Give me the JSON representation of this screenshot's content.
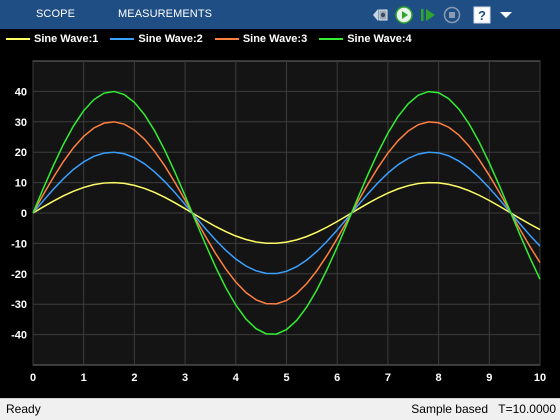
{
  "toolstrip": {
    "tabs": [
      {
        "label": "SCOPE"
      },
      {
        "label": "MEASUREMENTS"
      }
    ],
    "buttons": [
      {
        "icon": "snapshot-back-icon"
      },
      {
        "icon": "run-icon"
      },
      {
        "icon": "step-forward-icon"
      },
      {
        "icon": "stop-icon"
      },
      {
        "icon": "help-icon"
      },
      {
        "icon": "expand-icon"
      }
    ]
  },
  "legend": {
    "items": [
      {
        "label": "Sine Wave:1",
        "color": "#ffff66"
      },
      {
        "label": "Sine Wave:2",
        "color": "#3aa0ff"
      },
      {
        "label": "Sine Wave:3",
        "color": "#ff8040"
      },
      {
        "label": "Sine Wave:4",
        "color": "#33ee33"
      }
    ]
  },
  "chart_data": {
    "type": "line",
    "xlim": [
      0,
      10
    ],
    "ylim": [
      -50,
      50
    ],
    "xticks": [
      0,
      1,
      2,
      3,
      4,
      5,
      6,
      7,
      8,
      9,
      10
    ],
    "yticks": [
      -40,
      -30,
      -20,
      -10,
      0,
      10,
      20,
      30,
      40
    ],
    "grid": true,
    "x": [
      0,
      0.2,
      0.4,
      0.6,
      0.8,
      1.0,
      1.2,
      1.4,
      1.6,
      1.8,
      2.0,
      2.2,
      2.4,
      2.6,
      2.8,
      3.0,
      3.2,
      3.4,
      3.6,
      3.8,
      4.0,
      4.2,
      4.4,
      4.6,
      4.8,
      5.0,
      5.2,
      5.4,
      5.6,
      5.8,
      6.0,
      6.2,
      6.4,
      6.6,
      6.8,
      7.0,
      7.2,
      7.4,
      7.6,
      7.8,
      8.0,
      8.2,
      8.4,
      8.6,
      8.8,
      9.0,
      9.2,
      9.4,
      9.6,
      9.8,
      10.0
    ],
    "series": [
      {
        "name": "Sine Wave:1",
        "color": "#ffff66",
        "values": [
          0,
          1.99,
          3.89,
          5.65,
          7.17,
          8.41,
          9.32,
          9.85,
          10.0,
          9.74,
          9.09,
          8.08,
          6.75,
          5.16,
          3.35,
          1.41,
          -0.58,
          -2.55,
          -4.43,
          -6.12,
          -7.57,
          -8.72,
          -9.52,
          -9.94,
          -9.96,
          -9.59,
          -8.83,
          -7.73,
          -6.31,
          -4.64,
          -2.79,
          -0.83,
          1.17,
          3.11,
          4.94,
          6.57,
          7.93,
          8.99,
          9.69,
          9.99,
          9.89,
          9.4,
          8.55,
          7.34,
          5.84,
          4.12,
          2.23,
          0.25,
          -1.75,
          -3.66,
          -5.44
        ]
      },
      {
        "name": "Sine Wave:2",
        "color": "#3aa0ff",
        "values": [
          0,
          3.97,
          7.79,
          11.29,
          14.35,
          16.83,
          18.64,
          19.71,
          19.99,
          19.48,
          18.19,
          16.17,
          13.51,
          10.31,
          6.7,
          2.82,
          -1.17,
          -5.1,
          -8.85,
          -12.24,
          -15.14,
          -17.43,
          -19.03,
          -19.87,
          -19.92,
          -19.18,
          -17.67,
          -15.45,
          -12.62,
          -9.29,
          -5.59,
          -1.66,
          2.33,
          6.22,
          9.88,
          13.14,
          15.87,
          17.97,
          19.37,
          19.97,
          19.79,
          18.81,
          17.09,
          14.68,
          11.69,
          8.24,
          4.46,
          0.5,
          -3.49,
          -7.32,
          -10.88
        ]
      },
      {
        "name": "Sine Wave:3",
        "color": "#ff8040",
        "values": [
          0,
          5.96,
          11.68,
          16.94,
          21.52,
          25.24,
          27.96,
          29.56,
          29.99,
          29.22,
          27.28,
          24.25,
          20.26,
          15.47,
          10.05,
          4.23,
          -1.75,
          -7.65,
          -13.28,
          -18.37,
          -22.71,
          -26.15,
          -28.55,
          -29.81,
          -29.88,
          -28.77,
          -26.5,
          -23.18,
          -18.93,
          -13.93,
          -8.38,
          -2.49,
          3.5,
          9.33,
          14.82,
          19.71,
          23.8,
          26.96,
          29.06,
          29.96,
          29.68,
          28.21,
          25.64,
          22.02,
          17.53,
          12.36,
          6.69,
          0.75,
          -5.24,
          -10.98,
          -16.32
        ]
      },
      {
        "name": "Sine Wave:4",
        "color": "#33ee33",
        "values": [
          0,
          7.95,
          15.58,
          22.59,
          28.69,
          33.66,
          37.28,
          39.42,
          39.98,
          38.95,
          36.37,
          32.34,
          27.02,
          20.62,
          13.4,
          5.64,
          -2.34,
          -10.2,
          -17.7,
          -24.49,
          -30.27,
          -34.87,
          -38.06,
          -39.75,
          -39.84,
          -38.36,
          -35.34,
          -30.9,
          -25.24,
          -18.58,
          -11.18,
          -3.32,
          4.66,
          12.44,
          19.76,
          26.28,
          31.73,
          35.94,
          38.75,
          39.94,
          39.57,
          37.61,
          34.18,
          29.36,
          23.38,
          16.48,
          8.93,
          1.0,
          -6.98,
          -14.64,
          -21.76
        ]
      }
    ]
  },
  "status": {
    "left": "Ready",
    "mode": "Sample based",
    "time": "T=10.0000"
  }
}
